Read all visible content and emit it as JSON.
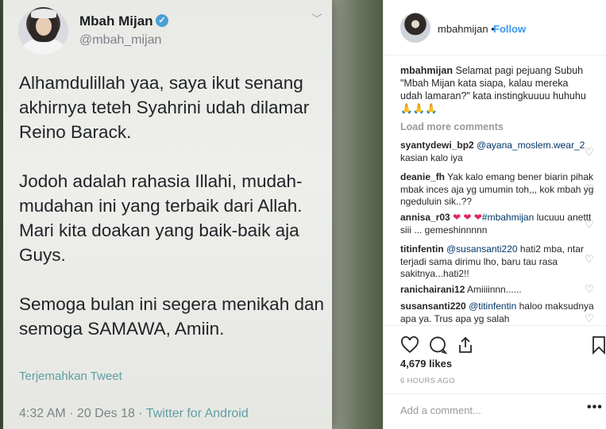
{
  "tweet": {
    "name": "Mbah Mijan",
    "handle": "@mbah_mijan",
    "paragraphs": [
      "Alhamdulillah yaa, saya ikut senang akhirnya teteh Syahrini udah dilamar Reino Barack.",
      "Jodoh adalah rahasia Illahi, mudah-mudahan ini yang terbaik dari Allah. Mari kita doakan yang baik-baik aja Guys.",
      "Semoga bulan ini segera menikah dan semoga SAMAWA, Amiin."
    ],
    "translate_label": "Terjemahkan Tweet",
    "timestamp": "4:32 AM · 20 Des 18 · ",
    "source": "Twitter for Android"
  },
  "instagram": {
    "username": "mbahmijan",
    "separator": "•",
    "follow_label": "Follow",
    "caption_user": "mbahmijan",
    "caption_text": "Selamat pagi pejuang Subuh \"Mbah Mijan kata siapa, kalau mereka udah lamaran?\" kata instingkuuuu huhuhu 🙏🙏🙏",
    "load_more": "Load more comments",
    "comments": [
      {
        "user": "syantydewi_bp2",
        "mention": "@ayana_moslem.wear_2",
        "text": " kasian kalo iya"
      },
      {
        "user": "deanie_fh",
        "mention": "",
        "text": "Yak kalo emang bener biarin pihak mbak inces aja yg umumin toh,,, kok mbah yg ngeduluin sik..??"
      },
      {
        "user": "annisa_r03",
        "mention": "#mbahmijan",
        "text": " lucuuu anettt siii ... gemeshinnnnn",
        "hearts": "❤ ❤ ❤"
      },
      {
        "user": "titinfentin",
        "mention": "@susansanti220",
        "text": " hati2 mba, ntar terjadi sama dirimu lho, baru tau rasa sakitnya...hati2!!"
      },
      {
        "user": "ranichairani12",
        "mention": "",
        "text": "Amiiiinnn......"
      },
      {
        "user": "susansanti220",
        "mention": "@titinfentin",
        "text": " haloo maksudnya apa ya. Trus apa yg salah"
      }
    ],
    "likes": "4,679 likes",
    "time_ago": "6 HOURS AGO",
    "add_comment_placeholder": "Add a comment...",
    "more_options": "•••",
    "icons": [
      "heart-icon",
      "comment-icon",
      "share-icon",
      "bookmark-icon"
    ]
  }
}
